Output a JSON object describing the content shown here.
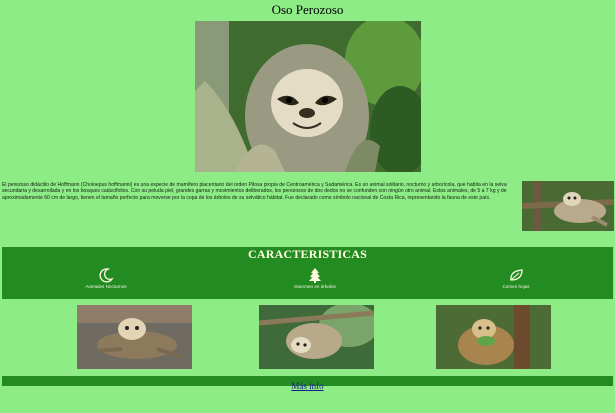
{
  "page": {
    "title": "Oso Perozoso"
  },
  "description": "El perezoso didáctilo de Hoffmann (Choloepus hoffmanni) es una especie de mamífero placentario del orden Pilosa propia de Centroamérica y Sudamérica. Es un animal solitario, nocturno y arborícola, que habita en la selva secundaria y desarrollada y en los bosques caducifolios. Con su peluda piel, grandes garras y movimientos deliberados, los perezosos de dos dedos no se confunden con ningún otro animal. Estos animales, de 5 a 7 kg y de aproximadamente 60 cm de largo, tienen el tamaño perfecto para moverse por la copa de los árboles de su selvático hábitat. Fue declarado como símbolo nacional de Costa Rica, representando la fauna de este país.",
  "features": {
    "title": "CARACTERISTICAS",
    "items": [
      {
        "label": "Animales Nocturnos",
        "icon": "moon-icon"
      },
      {
        "label": "Duermen en árboles",
        "icon": "tree-icon"
      },
      {
        "label": "Comen hojas",
        "icon": "leaf-icon"
      }
    ]
  },
  "more_link": {
    "label": "Más info"
  },
  "colors": {
    "background": "#8eec86",
    "band": "#228b22",
    "accent_text": "#ffffe0"
  }
}
